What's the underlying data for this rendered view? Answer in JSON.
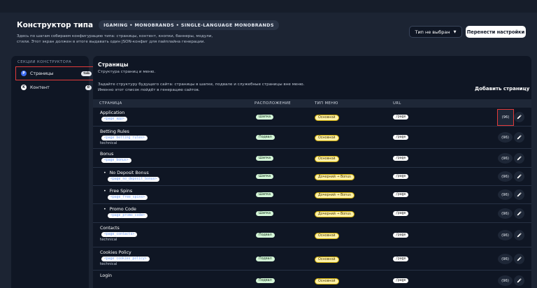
{
  "header": {
    "title": "Конструктор типа",
    "breadcrumb": "IGAMING • MONOBRANDS • SINGLE-LANGUAGE MONOBRANDS",
    "subtitle": "Здесь по шагам собираем конфигурацию типа: страницы, контент, кнопки, баннеры, модули, стили. Этот экран должен в итоге выдавать один JSON-конфиг для пайплайна генерации."
  },
  "toolbar": {
    "type_select": "Тип не выбран",
    "reset_button": "Перенести настройки"
  },
  "sidebar": {
    "section_label": "СЕКЦИИ КОНСТРУКТОРА",
    "items": [
      {
        "letter": "P",
        "label": "Страницы",
        "badge": "tab"
      },
      {
        "letter": "K",
        "label": "Контент",
        "badge": "0"
      }
    ]
  },
  "main": {
    "title": "Страницы",
    "subtitle": "Структура страниц и меню.",
    "description": "Задайте структуру будущего сайта: страницы в шапке, подвале и служебные страницы вне меню. Именно этот список пойдёт в генерацию сайтов.",
    "add_button": "Добавить страницу",
    "columns": [
      "СТРАНИЦА",
      "РАСПОЛОЖЕНИЕ",
      "ТИП МЕНЮ",
      "URL"
    ],
    "rows": [
      {
        "name": "Application",
        "code": "<page_app>",
        "tech": "",
        "location": "Шапка",
        "menu": "Основной",
        "url": "/page",
        "count": "(96)",
        "child": false
      },
      {
        "name": "Betting Rules",
        "code": "<page_betting_rules>",
        "tech": "technical",
        "location": "Подвал",
        "menu": "Основной",
        "url": "/page",
        "count": "(96)",
        "child": false
      },
      {
        "name": "Bonus",
        "code": "<page_bonus>",
        "tech": "",
        "location": "Шапка",
        "menu": "Основной",
        "url": "/page",
        "count": "(96)",
        "child": false
      },
      {
        "name": "No Deposit Bonus",
        "code": "<page_no_deposit_bonus>",
        "tech": "",
        "location": "Шапка",
        "menu": "Дочерний → Bonus",
        "url": "/page",
        "count": "(96)",
        "child": true
      },
      {
        "name": "Free Spins",
        "code": "<page_free_spins>",
        "tech": "",
        "location": "Шапка",
        "menu": "Дочерний → Bonus",
        "url": "/page",
        "count": "(96)",
        "child": true
      },
      {
        "name": "Promo Code",
        "code": "<page_promo_code>",
        "tech": "",
        "location": "Шапка",
        "menu": "Дочерний → Bonus",
        "url": "/page",
        "count": "(96)",
        "child": true
      },
      {
        "name": "Contacts",
        "code": "<page_contacts>",
        "tech": "technical",
        "location": "Подвал",
        "menu": "Основной",
        "url": "/page",
        "count": "(96)",
        "child": false
      },
      {
        "name": "Cookies Policy",
        "code": "<page_cookies_policy>",
        "tech": "technical",
        "location": "Подвал",
        "menu": "Основной",
        "url": "/page",
        "count": "(96)",
        "child": false
      },
      {
        "name": "Login",
        "code": "",
        "tech": "",
        "location": "Подвал",
        "menu": "Основной",
        "url": "/page",
        "count": "(96)",
        "child": false
      }
    ]
  },
  "colors": {
    "background": "#1c2433",
    "panel": "#0f1624",
    "accent": "#3d6df2",
    "highlight": "#e23a3a"
  },
  "icons": {
    "select_caret": "caret-down-icon",
    "edit": "pencil-icon"
  }
}
